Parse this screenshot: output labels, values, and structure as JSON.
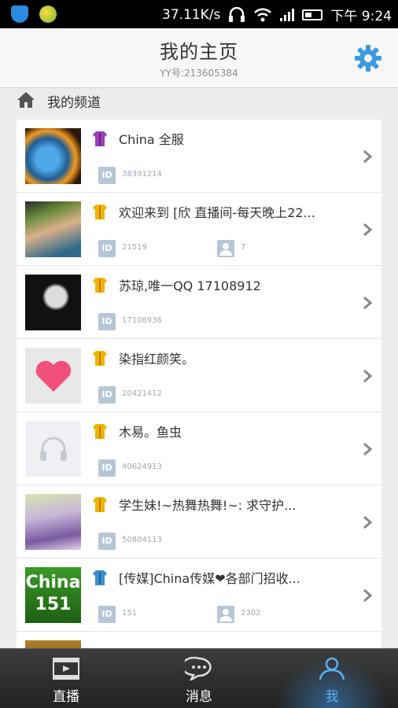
{
  "status_bar": {
    "speed": "37.11K/s",
    "time": "下午 9:24"
  },
  "header": {
    "title": "我的主页",
    "subtitle": "YY号:213605384"
  },
  "section": {
    "title": "我的频道"
  },
  "channels": [
    {
      "name": "China 全服",
      "id": "38391214",
      "users": ""
    },
    {
      "name": "欢迎来到 [欣 直播间-每天晚上22...",
      "id": "21519",
      "users": "7"
    },
    {
      "name": "苏琼,唯一QQ 17108912",
      "id": "17108936",
      "users": ""
    },
    {
      "name": "染指红颜笑。",
      "id": "20421412",
      "users": ""
    },
    {
      "name": "木易。鱼虫",
      "id": "40624913",
      "users": ""
    },
    {
      "name": "学生妹!~热舞热舞!~: 求守护...",
      "id": "50804113",
      "users": ""
    },
    {
      "name": "[传媒]China传媒❤各部门招收...",
      "id": "151",
      "users": "2302"
    },
    {
      "name": "",
      "id": "",
      "users": ""
    }
  ],
  "avatar_text": {
    "china": "China 151"
  },
  "nav": {
    "live": "直播",
    "messages": "消息",
    "me": "我"
  },
  "colors": {
    "accent": "#3d9ae0",
    "nav_active": "#5ab2f0",
    "badge": "#b6c6d6"
  },
  "icons": [
    "shield-icon",
    "app-icon",
    "headset-icon",
    "wifi-icon",
    "signal-icon",
    "battery-icon",
    "gear-icon",
    "home-icon",
    "rank-icon",
    "id-icon",
    "user-icon",
    "chevron-right-icon",
    "film-icon",
    "chat-bubble-icon",
    "person-icon"
  ]
}
